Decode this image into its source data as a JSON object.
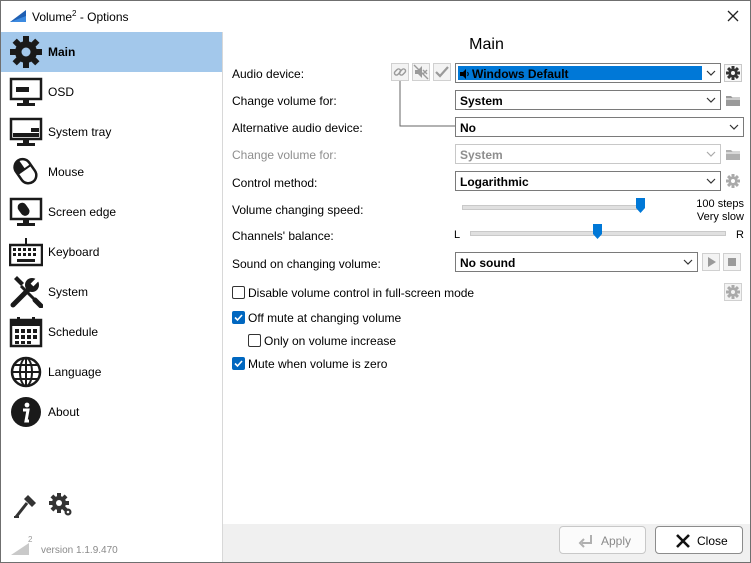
{
  "window": {
    "title_main": "Volume",
    "title_sup": "2",
    "title_rest": " - Options"
  },
  "sidebar": {
    "items": [
      {
        "label": "Main",
        "icon": "gear-icon"
      },
      {
        "label": "OSD",
        "icon": "monitor-icon"
      },
      {
        "label": "System tray",
        "icon": "system-tray-icon"
      },
      {
        "label": "Mouse",
        "icon": "mouse-icon"
      },
      {
        "label": "Screen edge",
        "icon": "screen-edge-icon"
      },
      {
        "label": "Keyboard",
        "icon": "keyboard-icon"
      },
      {
        "label": "System",
        "icon": "wrench-screwdriver-icon"
      },
      {
        "label": "Schedule",
        "icon": "calendar-icon"
      },
      {
        "label": "Language",
        "icon": "globe-icon"
      },
      {
        "label": "About",
        "icon": "info-icon"
      }
    ],
    "active_index": 0,
    "version_logo_sup": "2",
    "version": "version 1.1.9.470"
  },
  "main": {
    "title": "Main",
    "audio_device": {
      "label": "Audio device:",
      "value": "Windows Default"
    },
    "change_volume_for": {
      "label": "Change volume for:",
      "value": "System"
    },
    "alt_audio_device": {
      "label": "Alternative audio device:",
      "value": "No"
    },
    "change_volume_for_alt": {
      "label": "Change volume for:",
      "value": "System"
    },
    "control_method": {
      "label": "Control method:",
      "value": "Logarithmic"
    },
    "speed": {
      "label": "Volume changing speed:",
      "steps": "100 steps",
      "desc": "Very slow",
      "level": 1.0
    },
    "balance": {
      "label": "Channels' balance:",
      "left": "L",
      "right": "R",
      "level": 0.5
    },
    "sound": {
      "label": "Sound on changing volume:",
      "value": "No sound"
    },
    "checkboxes": [
      {
        "label": "Disable volume control in full-screen mode",
        "checked": false
      },
      {
        "label": "Off mute at changing volume",
        "checked": true
      },
      {
        "label": "Only on volume increase",
        "checked": false
      },
      {
        "label": "Mute when volume is zero",
        "checked": true
      }
    ]
  },
  "footer": {
    "apply_label": "Apply",
    "close_label": "Close"
  },
  "colors": {
    "active_nav": "#a3c8eb",
    "accent": "#0078d7",
    "checkbox": "#0067c0"
  }
}
